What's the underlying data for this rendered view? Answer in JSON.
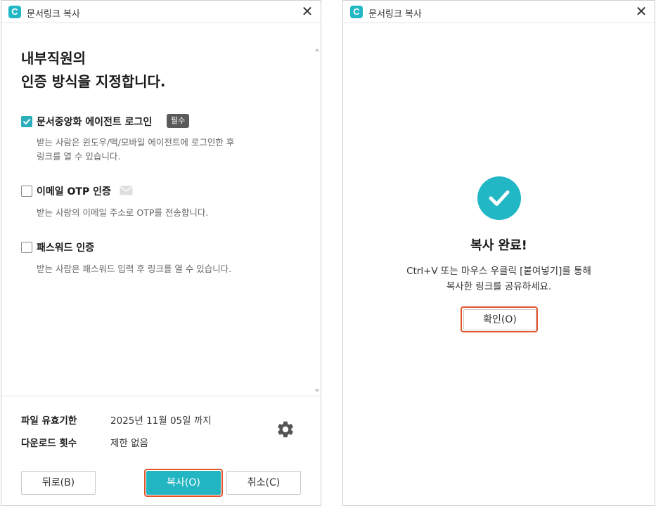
{
  "left_window": {
    "title": "문서링크 복사",
    "app_icon_letter": "C",
    "close_glyph": "✕",
    "heading_line1": "내부직원의",
    "heading_line2": "인증 방식을 지정합니다.",
    "options": [
      {
        "label": "문서중앙화 에이전트 로그인",
        "badge": "필수",
        "checked": true,
        "desc_line1": "받는 사람은 윈도우/맥/모바일 에이전트에 로그인한 후",
        "desc_line2": "링크를 열 수 있습니다."
      },
      {
        "label": "이메일 OTP 인증",
        "icon": "mail-icon",
        "checked": false,
        "desc_line1": "받는 사람의 이메일 주소로 OTP를 전송합니다."
      },
      {
        "label": "패스워드 인증",
        "checked": false,
        "desc_line1": "받는 사람은 패스워드 입력 후 링크를 열 수 있습니다."
      }
    ],
    "expiry_label": "파일 유효기한",
    "expiry_value": "2025년 11월 05일 까지",
    "download_label": "다운로드 횟수",
    "download_value": "제한 없음",
    "settings_icon": "gear-icon",
    "back_button": "뒤로(B)",
    "copy_button": "복사(O)",
    "cancel_button": "취소(C)"
  },
  "right_window": {
    "title": "문서링크 복사",
    "app_icon_letter": "C",
    "close_glyph": "✕",
    "success_icon": "check-circle-icon",
    "done_title": "복사 완료!",
    "done_message_line1": "Ctrl+V 또는 마우스 우클릭 [붙여넣기]를 통해",
    "done_message_line2": "복사한 링크를 공유하세요.",
    "confirm_button": "확인(O)"
  },
  "colors": {
    "accent": "#22b5c2",
    "highlight": "#e2552b",
    "badge": "#5a5a5a"
  }
}
